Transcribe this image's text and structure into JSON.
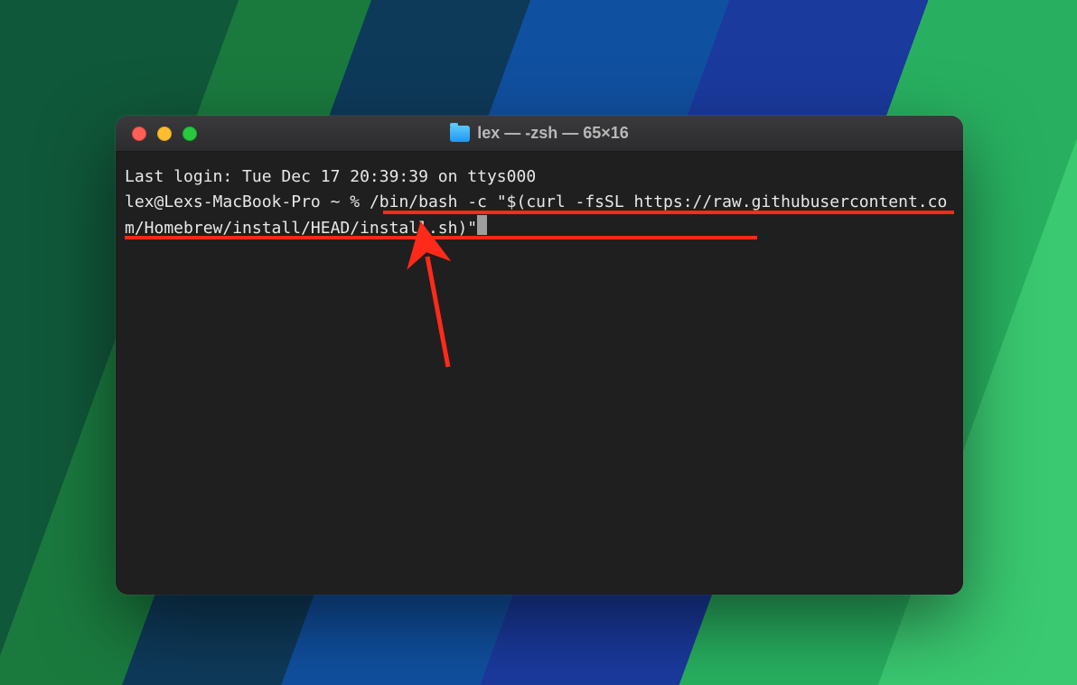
{
  "window": {
    "title": "lex — -zsh — 65×16"
  },
  "terminal": {
    "last_login_line": "Last login: Tue Dec 17 20:39:39 on ttys000",
    "prompt": "lex@Lexs-MacBook-Pro ~ % ",
    "command": "/bin/bash -c \"$(curl -fsSL https://raw.githubusercontent.com/Homebrew/install/HEAD/install.sh)\""
  },
  "annotation": {
    "color": "#ff2a1a"
  }
}
